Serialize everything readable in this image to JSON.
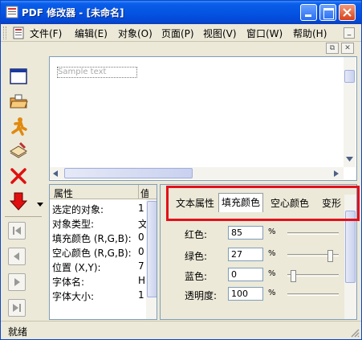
{
  "window": {
    "title": "PDF 修改器 - [未命名]"
  },
  "menu": {
    "items": [
      "文件(F)",
      "编辑(E)",
      "对象(O)",
      "页面(P)",
      "视图(V)",
      "窗口(W)",
      "帮助(H)"
    ]
  },
  "canvas": {
    "selected_text": "Sample text"
  },
  "properties": {
    "header_name": "属性",
    "header_value": "值",
    "rows": [
      {
        "name": "选定的对象:",
        "value": "1"
      },
      {
        "name": "对象类型:",
        "value": "文"
      },
      {
        "name": "填充颜色 (R,G,B):",
        "value": "0"
      },
      {
        "name": "空心颜色 (R,G,B):",
        "value": "0"
      },
      {
        "name": "位置 (X,Y):",
        "value": "7"
      },
      {
        "name": "字体名:",
        "value": "H"
      },
      {
        "name": "字体大小:",
        "value": "1"
      }
    ]
  },
  "panel": {
    "tabs": [
      "文本属性",
      "填充颜色",
      "空心颜色",
      "变形"
    ],
    "active_tab": 1,
    "fields": [
      {
        "label": "红色:",
        "value": "85",
        "unit": "%",
        "level": 0.85
      },
      {
        "label": "绿色:",
        "value": "27",
        "unit": "%",
        "level": 0.27
      },
      {
        "label": "蓝色:",
        "value": "0",
        "unit": "%",
        "level": 0.0
      },
      {
        "label": "透明度:",
        "value": "100",
        "unit": "%",
        "level": 1.0
      }
    ]
  },
  "status": {
    "text": "就绪"
  },
  "colors": {
    "titlebar": "#0554e3",
    "highlight": "#e3101a",
    "chrome": "#ece9d8"
  }
}
